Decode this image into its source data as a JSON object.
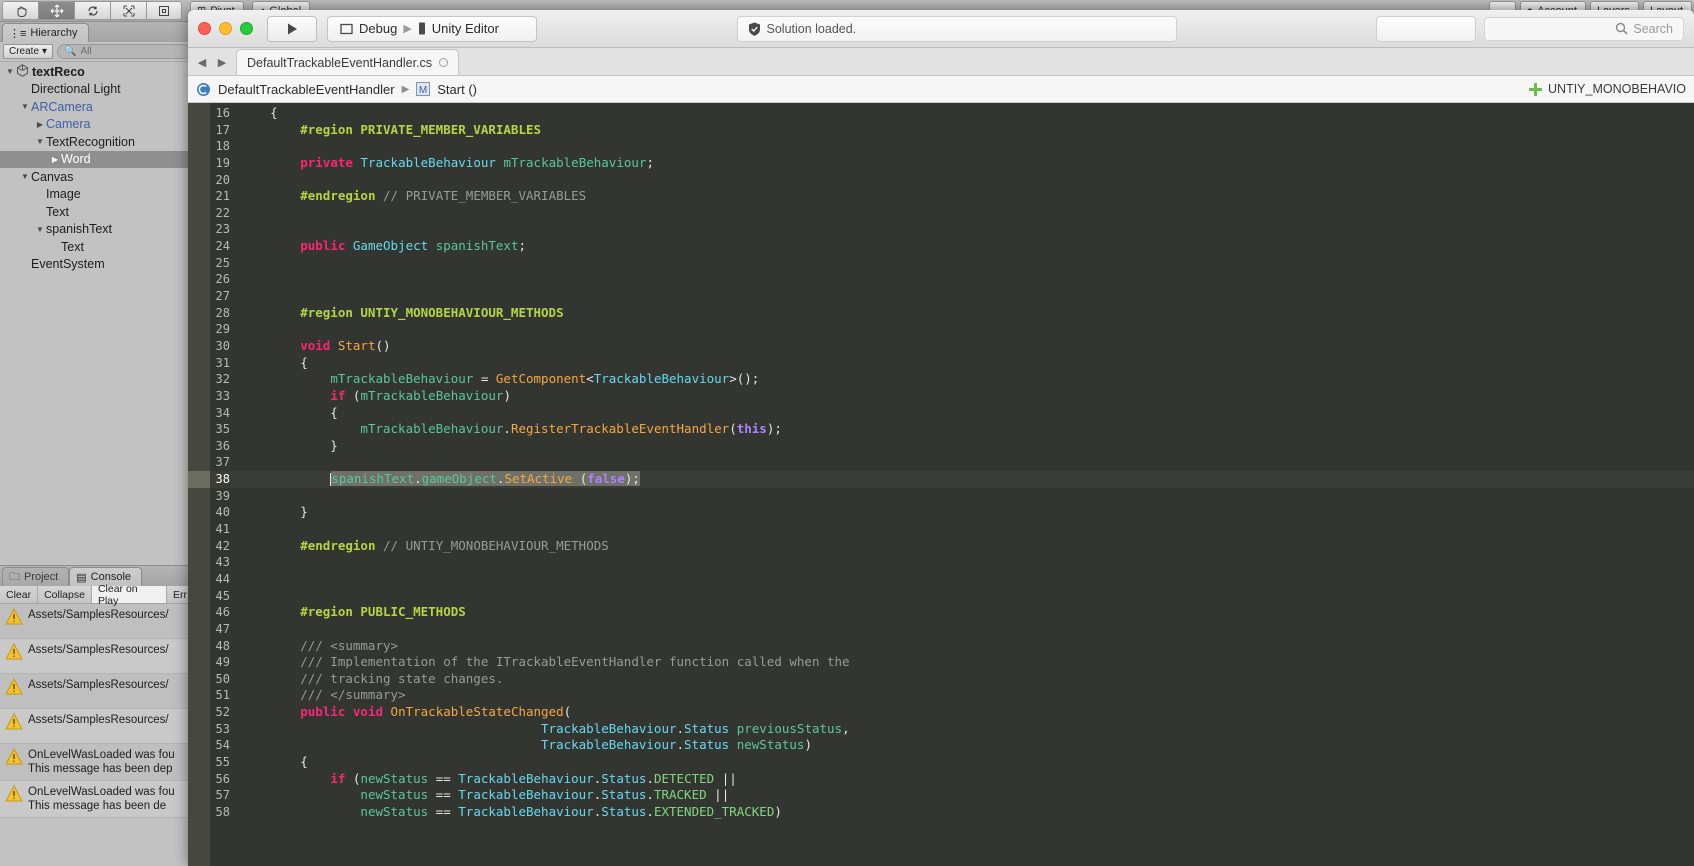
{
  "unity": {
    "toolbar": {
      "tools": [
        {
          "name": "hand-tool",
          "active": false
        },
        {
          "name": "move-tool",
          "active": true
        },
        {
          "name": "rotate-tool",
          "active": false
        },
        {
          "name": "scale-tool",
          "active": false
        },
        {
          "name": "rect-tool",
          "active": false
        }
      ],
      "pivot_label": "Pivot",
      "global_label": "Global",
      "account_label": "Account",
      "layers_label": "Layers",
      "layout_label": "Layout"
    },
    "hierarchy": {
      "tab_label": "Hierarchy",
      "create_label": "Create",
      "search_placeholder": "All",
      "items": [
        {
          "label": "textReco",
          "depth": 0,
          "arrow": "down",
          "bold": true,
          "blue": false,
          "selected": false,
          "unity_icon": true
        },
        {
          "label": "Directional Light",
          "depth": 1,
          "arrow": "none",
          "bold": false,
          "blue": false,
          "selected": false
        },
        {
          "label": "ARCamera",
          "depth": 1,
          "arrow": "down",
          "bold": false,
          "blue": true,
          "selected": false
        },
        {
          "label": "Camera",
          "depth": 2,
          "arrow": "right",
          "bold": false,
          "blue": true,
          "selected": false
        },
        {
          "label": "TextRecognition",
          "depth": 2,
          "arrow": "down",
          "bold": false,
          "blue": false,
          "selected": false
        },
        {
          "label": "Word",
          "depth": 3,
          "arrow": "right",
          "bold": false,
          "blue": false,
          "selected": true
        },
        {
          "label": "Canvas",
          "depth": 1,
          "arrow": "down",
          "bold": false,
          "blue": false,
          "selected": false
        },
        {
          "label": "Image",
          "depth": 2,
          "arrow": "none",
          "bold": false,
          "blue": false,
          "selected": false
        },
        {
          "label": "Text",
          "depth": 2,
          "arrow": "none",
          "bold": false,
          "blue": false,
          "selected": false
        },
        {
          "label": "spanishText",
          "depth": 2,
          "arrow": "down",
          "bold": false,
          "blue": false,
          "selected": false
        },
        {
          "label": "Text",
          "depth": 3,
          "arrow": "none",
          "bold": false,
          "blue": false,
          "selected": false
        },
        {
          "label": "EventSystem",
          "depth": 1,
          "arrow": "none",
          "bold": false,
          "blue": false,
          "selected": false
        }
      ]
    },
    "console": {
      "project_tab_label": "Project",
      "console_tab_label": "Console",
      "buttons": [
        "Clear",
        "Collapse",
        "Clear on Play",
        "Err"
      ],
      "logs": [
        {
          "icon": "warning-icon",
          "line1": "Assets/SamplesResources/",
          "line2": ""
        },
        {
          "icon": "warning-icon",
          "line1": "Assets/SamplesResources/",
          "line2": ""
        },
        {
          "icon": "warning-icon",
          "line1": "Assets/SamplesResources/",
          "line2": ""
        },
        {
          "icon": "warning-icon",
          "line1": "Assets/SamplesResources/",
          "line2": ""
        },
        {
          "icon": "warning-icon",
          "line1": "OnLevelWasLoaded was fou",
          "line2": "This message has been dep"
        },
        {
          "icon": "warning-icon",
          "line1": "OnLevelWasLoaded was fou",
          "line2": "This message has been de"
        }
      ]
    }
  },
  "monodevelop": {
    "titlebar": {
      "run_icon": "play-icon",
      "config_label": "Debug",
      "target_label": "Unity Editor",
      "status_text": "Solution loaded.",
      "status_icon": "check-shield-icon",
      "search_placeholder": "Search",
      "search_icon": "search-icon"
    },
    "tabbar": {
      "back_icon": "chevron-left-icon",
      "forward_icon": "chevron-right-icon",
      "file_tab_label": "DefaultTrackableEventHandler.cs"
    },
    "breadcrumb": {
      "class_label": "DefaultTrackableEventHandler",
      "member_label": "Start ()",
      "class_icon": "class-icon",
      "member_icon": "method-icon",
      "region_label": "UNTIY_MONOBEHAVIO",
      "region_icon": "plus-icon"
    },
    "editor": {
      "first_line": 16,
      "highlighted_line": 38,
      "lines": [
        {
          "n": 16,
          "tokens": [
            {
              "t": "punct",
              "s": "    {"
            }
          ]
        },
        {
          "n": 17,
          "tokens": [
            {
              "t": "pre",
              "s": "        #region PRIVATE_MEMBER_VARIABLES"
            }
          ]
        },
        {
          "n": 18,
          "tokens": []
        },
        {
          "n": 19,
          "tokens": [
            {
              "t": "plain",
              "s": "        "
            },
            {
              "t": "kw",
              "s": "private"
            },
            {
              "t": "plain",
              "s": " "
            },
            {
              "t": "type",
              "s": "TrackableBehaviour"
            },
            {
              "t": "plain",
              "s": " "
            },
            {
              "t": "ident",
              "s": "mTrackableBehaviour"
            },
            {
              "t": "punct",
              "s": ";"
            }
          ]
        },
        {
          "n": 20,
          "tokens": []
        },
        {
          "n": 21,
          "tokens": [
            {
              "t": "plain",
              "s": "        "
            },
            {
              "t": "pre",
              "s": "#endregion"
            },
            {
              "t": "plain",
              "s": " "
            },
            {
              "t": "cmt",
              "s": "// PRIVATE_MEMBER_VARIABLES"
            }
          ]
        },
        {
          "n": 22,
          "tokens": []
        },
        {
          "n": 23,
          "tokens": []
        },
        {
          "n": 24,
          "tokens": [
            {
              "t": "plain",
              "s": "        "
            },
            {
              "t": "kw",
              "s": "public"
            },
            {
              "t": "plain",
              "s": " "
            },
            {
              "t": "type",
              "s": "GameObject"
            },
            {
              "t": "plain",
              "s": " "
            },
            {
              "t": "ident",
              "s": "spanishText"
            },
            {
              "t": "punct",
              "s": ";"
            }
          ]
        },
        {
          "n": 25,
          "tokens": []
        },
        {
          "n": 26,
          "tokens": []
        },
        {
          "n": 27,
          "tokens": []
        },
        {
          "n": 28,
          "tokens": [
            {
              "t": "pre",
              "s": "        #region UNTIY_MONOBEHAVIOUR_METHODS"
            }
          ]
        },
        {
          "n": 29,
          "tokens": []
        },
        {
          "n": 30,
          "tokens": [
            {
              "t": "plain",
              "s": "        "
            },
            {
              "t": "kw",
              "s": "void"
            },
            {
              "t": "plain",
              "s": " "
            },
            {
              "t": "fn",
              "s": "Start"
            },
            {
              "t": "punct",
              "s": "()"
            }
          ]
        },
        {
          "n": 31,
          "tokens": [
            {
              "t": "punct",
              "s": "        {"
            }
          ]
        },
        {
          "n": 32,
          "tokens": [
            {
              "t": "plain",
              "s": "            "
            },
            {
              "t": "ident",
              "s": "mTrackableBehaviour"
            },
            {
              "t": "punct",
              "s": " = "
            },
            {
              "t": "fn",
              "s": "GetComponent"
            },
            {
              "t": "punct",
              "s": "<"
            },
            {
              "t": "type",
              "s": "TrackableBehaviour"
            },
            {
              "t": "punct",
              "s": ">();"
            }
          ]
        },
        {
          "n": 33,
          "tokens": [
            {
              "t": "plain",
              "s": "            "
            },
            {
              "t": "kw",
              "s": "if"
            },
            {
              "t": "punct",
              "s": " ("
            },
            {
              "t": "ident",
              "s": "mTrackableBehaviour"
            },
            {
              "t": "punct",
              "s": ")"
            }
          ]
        },
        {
          "n": 34,
          "tokens": [
            {
              "t": "punct",
              "s": "            {"
            }
          ]
        },
        {
          "n": 35,
          "tokens": [
            {
              "t": "plain",
              "s": "                "
            },
            {
              "t": "ident",
              "s": "mTrackableBehaviour"
            },
            {
              "t": "punct",
              "s": "."
            },
            {
              "t": "fn",
              "s": "RegisterTrackableEventHandler"
            },
            {
              "t": "punct",
              "s": "("
            },
            {
              "t": "const",
              "s": "this"
            },
            {
              "t": "punct",
              "s": ");"
            }
          ]
        },
        {
          "n": 36,
          "tokens": [
            {
              "t": "punct",
              "s": "            }"
            }
          ]
        },
        {
          "n": 37,
          "tokens": []
        },
        {
          "n": 38,
          "selected": true,
          "tokens": [
            {
              "t": "plain",
              "s": "            "
            },
            {
              "t": "ident",
              "s": "spanishText"
            },
            {
              "t": "punct",
              "s": "."
            },
            {
              "t": "ident",
              "s": "gameObject"
            },
            {
              "t": "punct",
              "s": "."
            },
            {
              "t": "fn",
              "s": "SetActive"
            },
            {
              "t": "punct",
              "s": " ("
            },
            {
              "t": "const",
              "s": "false"
            },
            {
              "t": "punct",
              "s": ");"
            }
          ]
        },
        {
          "n": 39,
          "tokens": []
        },
        {
          "n": 40,
          "tokens": [
            {
              "t": "punct",
              "s": "        }"
            }
          ]
        },
        {
          "n": 41,
          "tokens": []
        },
        {
          "n": 42,
          "tokens": [
            {
              "t": "plain",
              "s": "        "
            },
            {
              "t": "pre",
              "s": "#endregion"
            },
            {
              "t": "plain",
              "s": " "
            },
            {
              "t": "cmt",
              "s": "// UNTIY_MONOBEHAVIOUR_METHODS"
            }
          ]
        },
        {
          "n": 43,
          "tokens": []
        },
        {
          "n": 44,
          "tokens": []
        },
        {
          "n": 45,
          "tokens": []
        },
        {
          "n": 46,
          "tokens": [
            {
              "t": "pre",
              "s": "        #region PUBLIC_METHODS"
            }
          ]
        },
        {
          "n": 47,
          "tokens": []
        },
        {
          "n": 48,
          "tokens": [
            {
              "t": "cmt",
              "s": "        /// <summary>"
            }
          ]
        },
        {
          "n": 49,
          "tokens": [
            {
              "t": "cmt",
              "s": "        /// Implementation of the ITrackableEventHandler function called when the"
            }
          ]
        },
        {
          "n": 50,
          "tokens": [
            {
              "t": "cmt",
              "s": "        /// tracking state changes."
            }
          ]
        },
        {
          "n": 51,
          "tokens": [
            {
              "t": "cmt",
              "s": "        /// </summary>"
            }
          ]
        },
        {
          "n": 52,
          "tokens": [
            {
              "t": "plain",
              "s": "        "
            },
            {
              "t": "kw",
              "s": "public"
            },
            {
              "t": "plain",
              "s": " "
            },
            {
              "t": "kw",
              "s": "void"
            },
            {
              "t": "plain",
              "s": " "
            },
            {
              "t": "fn",
              "s": "OnTrackableStateChanged"
            },
            {
              "t": "punct",
              "s": "("
            }
          ]
        },
        {
          "n": 53,
          "tokens": [
            {
              "t": "plain",
              "s": "                                        "
            },
            {
              "t": "type",
              "s": "TrackableBehaviour"
            },
            {
              "t": "punct",
              "s": "."
            },
            {
              "t": "type",
              "s": "Status"
            },
            {
              "t": "plain",
              "s": " "
            },
            {
              "t": "ident",
              "s": "previousStatus"
            },
            {
              "t": "punct",
              "s": ","
            }
          ]
        },
        {
          "n": 54,
          "tokens": [
            {
              "t": "plain",
              "s": "                                        "
            },
            {
              "t": "type",
              "s": "TrackableBehaviour"
            },
            {
              "t": "punct",
              "s": "."
            },
            {
              "t": "type",
              "s": "Status"
            },
            {
              "t": "plain",
              "s": " "
            },
            {
              "t": "ident",
              "s": "newStatus"
            },
            {
              "t": "punct",
              "s": ")"
            }
          ]
        },
        {
          "n": 55,
          "tokens": [
            {
              "t": "punct",
              "s": "        {"
            }
          ]
        },
        {
          "n": 56,
          "tokens": [
            {
              "t": "plain",
              "s": "            "
            },
            {
              "t": "kw",
              "s": "if"
            },
            {
              "t": "punct",
              "s": " ("
            },
            {
              "t": "ident",
              "s": "newStatus"
            },
            {
              "t": "punct",
              "s": " == "
            },
            {
              "t": "type",
              "s": "TrackableBehaviour"
            },
            {
              "t": "punct",
              "s": "."
            },
            {
              "t": "type",
              "s": "Status"
            },
            {
              "t": "punct",
              "s": "."
            },
            {
              "t": "enum",
              "s": "DETECTED"
            },
            {
              "t": "punct",
              "s": " ||"
            }
          ]
        },
        {
          "n": 57,
          "tokens": [
            {
              "t": "plain",
              "s": "                "
            },
            {
              "t": "ident",
              "s": "newStatus"
            },
            {
              "t": "punct",
              "s": " == "
            },
            {
              "t": "type",
              "s": "TrackableBehaviour"
            },
            {
              "t": "punct",
              "s": "."
            },
            {
              "t": "type",
              "s": "Status"
            },
            {
              "t": "punct",
              "s": "."
            },
            {
              "t": "enum",
              "s": "TRACKED"
            },
            {
              "t": "punct",
              "s": " ||"
            }
          ]
        },
        {
          "n": 58,
          "tokens": [
            {
              "t": "plain",
              "s": "                "
            },
            {
              "t": "ident",
              "s": "newStatus"
            },
            {
              "t": "punct",
              "s": " == "
            },
            {
              "t": "type",
              "s": "TrackableBehaviour"
            },
            {
              "t": "punct",
              "s": "."
            },
            {
              "t": "type",
              "s": "Status"
            },
            {
              "t": "punct",
              "s": "."
            },
            {
              "t": "enum",
              "s": "EXTENDED_TRACKED"
            },
            {
              "t": "punct",
              "s": ")"
            }
          ]
        }
      ]
    }
  },
  "colors": {
    "editor_bg": "#333630",
    "gutter_bg": "#46483f",
    "keyword": "#f92672",
    "type": "#66d9ef",
    "identifier": "#59c6a0",
    "function": "#f5a742",
    "preprocessor": "#b4d544",
    "comment": "#9a9c93",
    "constant": "#ae81ff",
    "enum": "#7fd87f",
    "selection": "#6f7168",
    "unity_chrome": "#c2c2c2",
    "warning": "#f2c230"
  }
}
